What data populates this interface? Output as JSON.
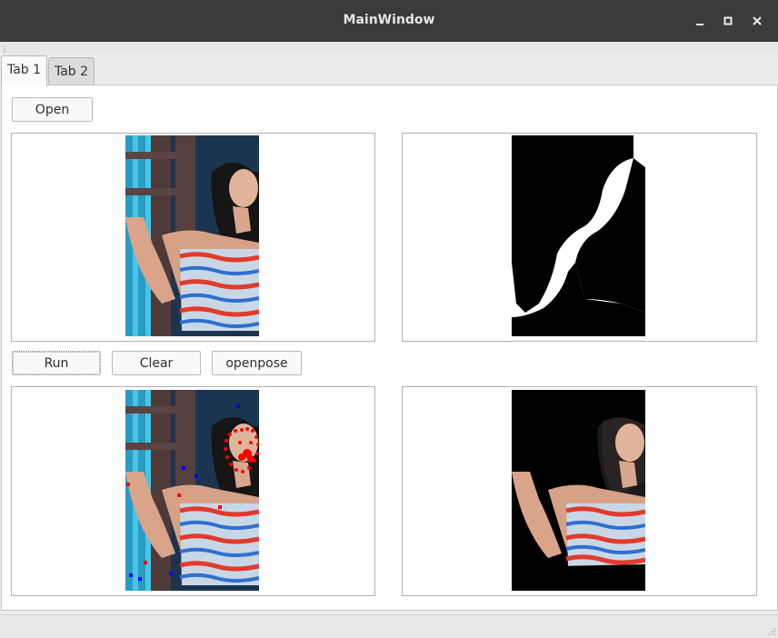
{
  "window": {
    "title": "MainWindow"
  },
  "tabs": [
    {
      "label": "Tab 1",
      "active": true
    },
    {
      "label": "Tab 2",
      "active": false
    }
  ],
  "toolbar": {
    "open_label": "Open"
  },
  "actions": {
    "run_label": "Run",
    "clear_label": "Clear",
    "openpose_label": "openpose"
  },
  "views": {
    "input_image": "woman-photo",
    "mask_image": "segmentation-mask",
    "pose_image": "pose-keypoints-overlay",
    "cutout_image": "person-cutout"
  },
  "colors": {
    "titlebar": "#3b3b3b",
    "keypoint_red": "#ff0000",
    "keypoint_blue": "#0000ff"
  }
}
